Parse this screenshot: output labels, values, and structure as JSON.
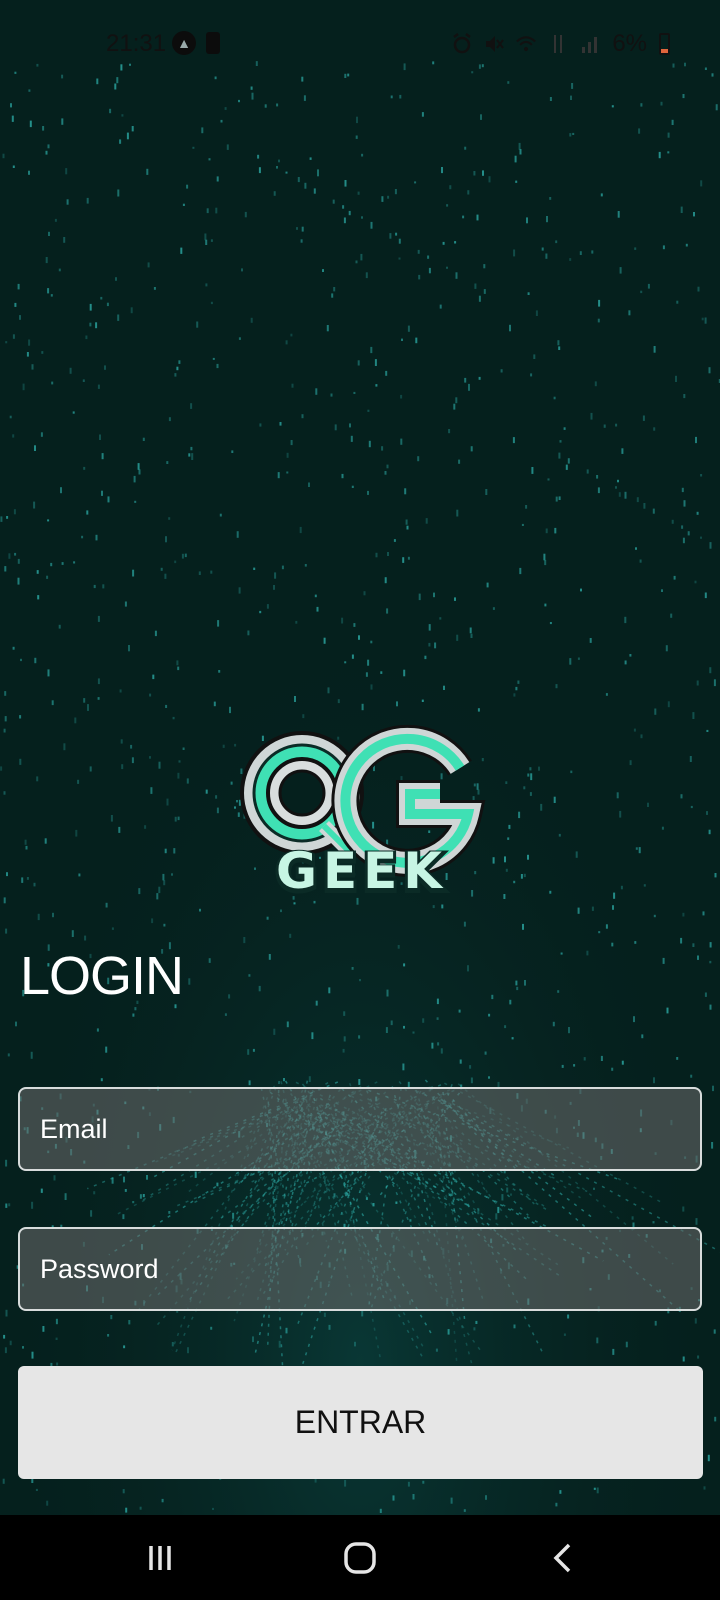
{
  "status_bar": {
    "time": "21:31",
    "battery": "6%",
    "icons": [
      "navigation-icon",
      "notification-icon",
      "alarm-icon",
      "mute-icon",
      "wifi-icon",
      "data-icon",
      "signal-icon",
      "battery-icon"
    ]
  },
  "logo": {
    "icon": "qg-geek-logo",
    "accent": "#3fe0b4"
  },
  "login": {
    "title": "LOGIN",
    "email_placeholder": "Email",
    "password_placeholder": "Password",
    "submit_label": "ENTRAR"
  },
  "nav_bar": {
    "buttons": [
      "recent-apps-icon",
      "home-icon",
      "back-icon"
    ]
  },
  "colors": {
    "background": "#041a18",
    "matrix": "#2fb5b0",
    "button": "#e6e6e6"
  }
}
